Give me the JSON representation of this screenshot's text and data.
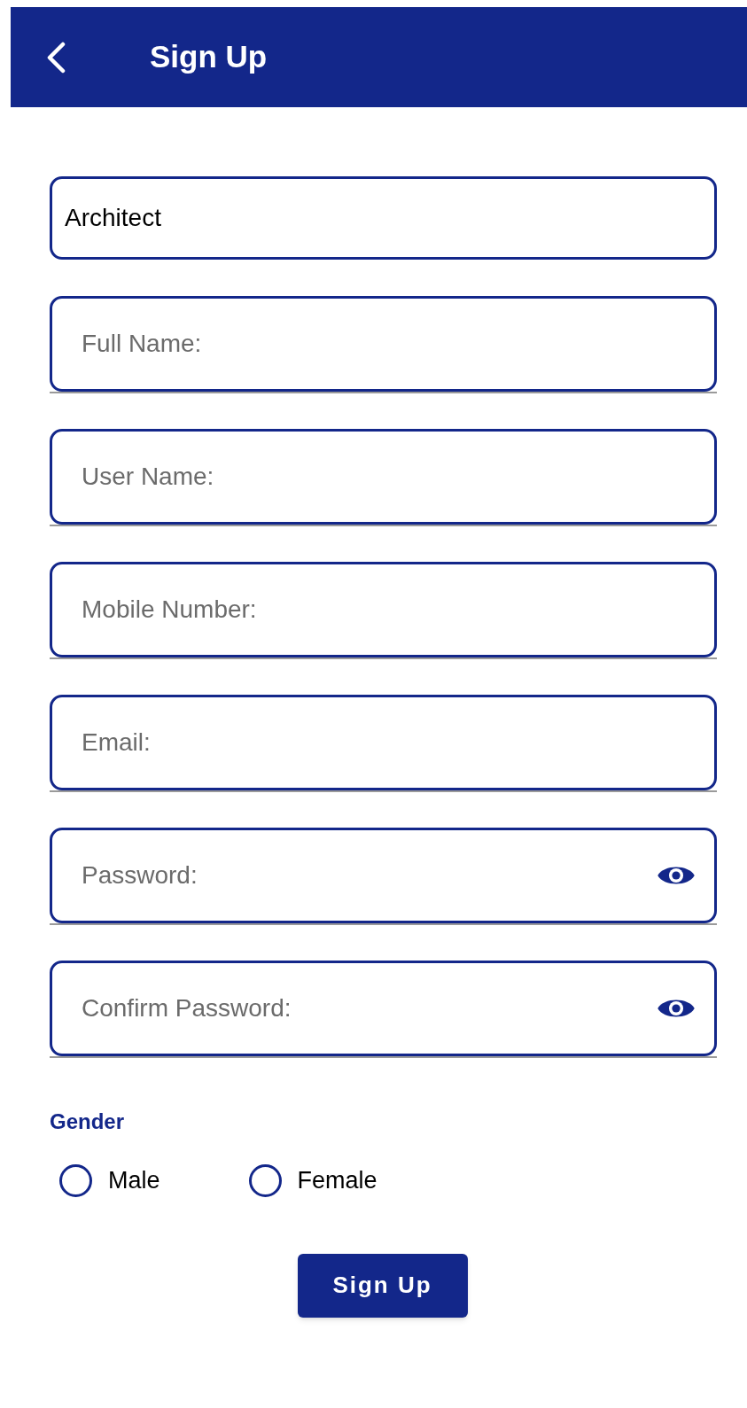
{
  "app_bar": {
    "title": "Sign Up"
  },
  "fields": [
    {
      "kind": "text",
      "value": "Architect"
    },
    {
      "kind": "text",
      "placeholder": "Full Name:"
    },
    {
      "kind": "text",
      "placeholder": "User Name:"
    },
    {
      "kind": "text",
      "placeholder": "Mobile Number:"
    },
    {
      "kind": "text",
      "placeholder": "Email:"
    },
    {
      "kind": "password",
      "placeholder": "Password:"
    },
    {
      "kind": "password",
      "placeholder": "Confirm Password:"
    }
  ],
  "gender": {
    "label": "Gender",
    "options": [
      {
        "label": "Male",
        "selected": false
      },
      {
        "label": "Female",
        "selected": false
      }
    ]
  },
  "submit_button": "Sign Up"
}
